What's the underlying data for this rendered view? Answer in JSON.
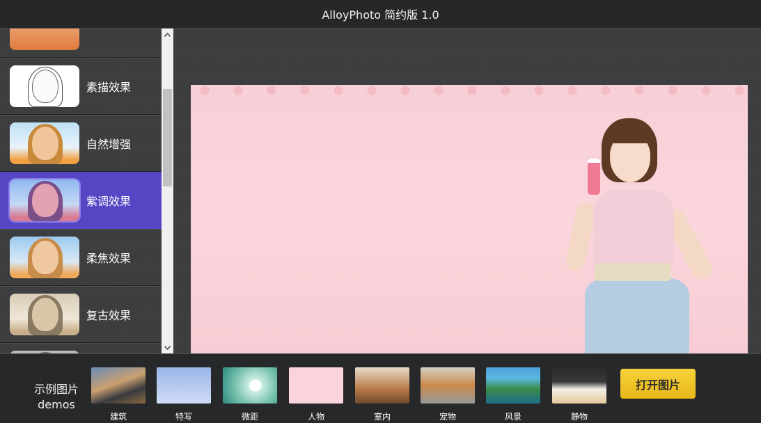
{
  "app": {
    "title": "AlloyPhoto 简约版 1.0"
  },
  "effects": [
    {
      "label": "",
      "thumb": "partial-top-thumb"
    },
    {
      "label": "素描效果",
      "thumb": "sketch"
    },
    {
      "label": "自然增强",
      "thumb": "natural"
    },
    {
      "label": "紫调效果",
      "thumb": "purple",
      "active": true
    },
    {
      "label": "柔焦效果",
      "thumb": "soft"
    },
    {
      "label": "复古效果",
      "thumb": "retro"
    },
    {
      "label": "",
      "thumb": "partial-bottom-thumb"
    }
  ],
  "scrollbar": {
    "up_icon": "chevron-up-icon",
    "down_icon": "chevron-down-icon"
  },
  "demos": {
    "label_cn": "示例图片",
    "label_en": "demos",
    "items": [
      {
        "name": "建筑"
      },
      {
        "name": "特写"
      },
      {
        "name": "微距"
      },
      {
        "name": "人物"
      },
      {
        "name": "室内"
      },
      {
        "name": "宠物"
      },
      {
        "name": "风景"
      },
      {
        "name": "静物"
      }
    ]
  },
  "open_button": {
    "label": "打开图片"
  },
  "colors": {
    "active_item": "#5547c4",
    "button": "#f2c52a",
    "topbar": "#262729"
  }
}
